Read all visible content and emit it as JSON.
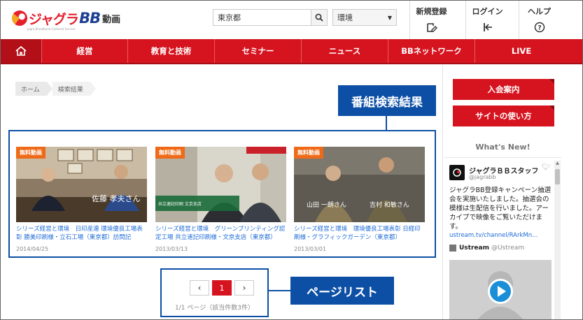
{
  "logo": {
    "brand_kana": "ジャグラ",
    "brand_bb": "BB",
    "brand_suffix": "動画",
    "tagline": "Jagra Broadband Contents Service"
  },
  "search": {
    "value": "東京都",
    "select_value": "環境"
  },
  "header_links": [
    {
      "label": "新規登録",
      "icon": "edit-icon"
    },
    {
      "label": "ログイン",
      "icon": "login-icon"
    },
    {
      "label": "ヘルプ",
      "icon": "help-icon"
    }
  ],
  "nav": {
    "home_icon": "home-icon",
    "items": [
      "経営",
      "教育と技術",
      "セミナー",
      "ニュース",
      "BBネットワーク",
      "LIVE"
    ]
  },
  "breadcrumb": [
    "ホーム",
    "検索結果"
  ],
  "callouts": {
    "results": "番組検索結果",
    "pager": "ページリスト"
  },
  "videos": [
    {
      "badge": "無料動画",
      "title": "シリーズ経営と環境　日印産連 環境優良工場表彰 勝美印刷様・立石工場（東京都）訪問記",
      "date": "2014/04/25"
    },
    {
      "badge": "無料動画",
      "title": "シリーズ経営と環境　グリーンプリンティング認定工場 共立速記印刷様・文京支店（東京都）",
      "date": "2013/03/13"
    },
    {
      "badge": "無料動画",
      "title": "シリーズ経営と環境　環境優良工場表彰 日経印刷様・グラフィックガーデン（東京都）",
      "date": "2013/03/01"
    }
  ],
  "pager": {
    "prev": "‹",
    "current": "1",
    "next": "›",
    "info": "1/1 ページ（該当件数3件）"
  },
  "sidebar": {
    "buttons": [
      "入会案内",
      "サイトの使い方"
    ],
    "whats_new": "What's New!",
    "tweet": {
      "name": "ジャグラＢＢスタッフ",
      "handle": "@jagrabb",
      "text": "ジャグラBB登録キャンペーン抽選会を実施いたしました。抽選会の模様は生配信を行いました。アーカイブで映像をご覧いただけます。",
      "link": "ustream.tv/channel/RArkMn...",
      "ustream_name": "Ustream",
      "ustream_handle": "@Ustream"
    }
  },
  "colors": {
    "brand_red": "#d6141f",
    "callout_blue": "#0d4fa5",
    "badge_orange": "#ef6a18",
    "link_blue": "#1d6bd6"
  }
}
